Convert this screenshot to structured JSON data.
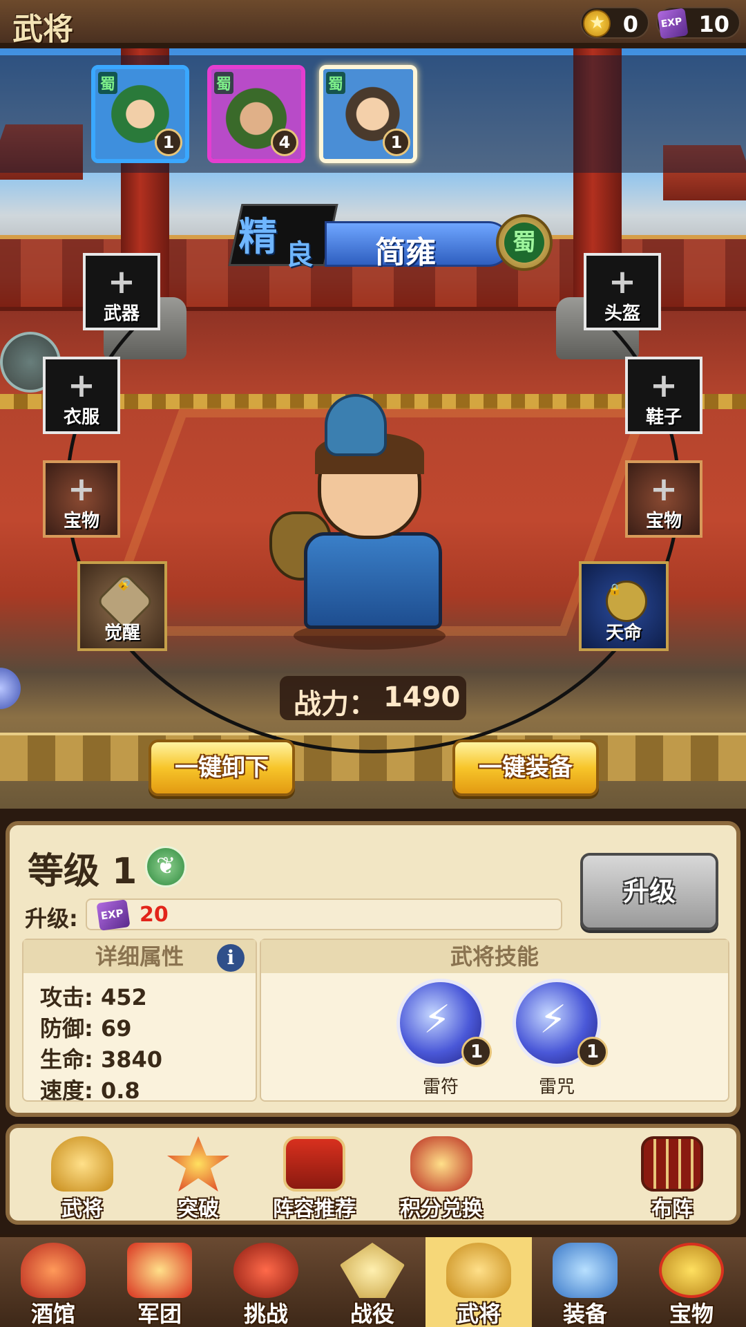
{
  "header": {
    "title": "武将",
    "gold": "0",
    "exp": "10",
    "gold_icon": "gold-star-coin",
    "exp_icon": "exp-crystal"
  },
  "hero_list": [
    {
      "faction": "蜀",
      "level": "1",
      "frame_color": "#3aa8ff",
      "selected": false
    },
    {
      "faction": "蜀",
      "level": "4",
      "frame_color": "#e43ed0",
      "selected": false
    },
    {
      "faction": "蜀",
      "level": "1",
      "frame_color": "#fff6d8",
      "selected": true
    }
  ],
  "hero": {
    "rank_char_1": "精",
    "rank_char_2": "良",
    "name": "简雍",
    "faction": "蜀"
  },
  "equipment_slots": {
    "weapon": "武器",
    "helmet": "头盔",
    "armor": "衣服",
    "boots": "鞋子",
    "treasure_left": "宝物",
    "treasure_right": "宝物",
    "awaken": "觉醒",
    "fate": "天命",
    "plus": "+"
  },
  "power": {
    "label": "战力：",
    "value": "1490"
  },
  "actions": {
    "unequip_all": "一键卸下",
    "equip_all": "一键装备"
  },
  "level_panel": {
    "level_label": "等级 1",
    "upgrade_label": "升级:",
    "cost_value": "20",
    "upgrade_button": "升级"
  },
  "attributes": {
    "title": "详细属性",
    "info_icon": "i",
    "rows": [
      "攻击: 452",
      "防御: 69",
      "生命: 3840",
      "速度: 0.8"
    ]
  },
  "skills": {
    "title": "武将技能",
    "items": [
      {
        "name": "雷符",
        "level": "1"
      },
      {
        "name": "雷咒",
        "level": "1"
      }
    ]
  },
  "functions": [
    "武将",
    "突破",
    "阵容推荐",
    "积分兑换",
    "布阵"
  ],
  "bottom_nav": {
    "active_index": 4,
    "items": [
      "酒馆",
      "军团",
      "挑战",
      "战役",
      "武将",
      "装备",
      "宝物"
    ]
  }
}
